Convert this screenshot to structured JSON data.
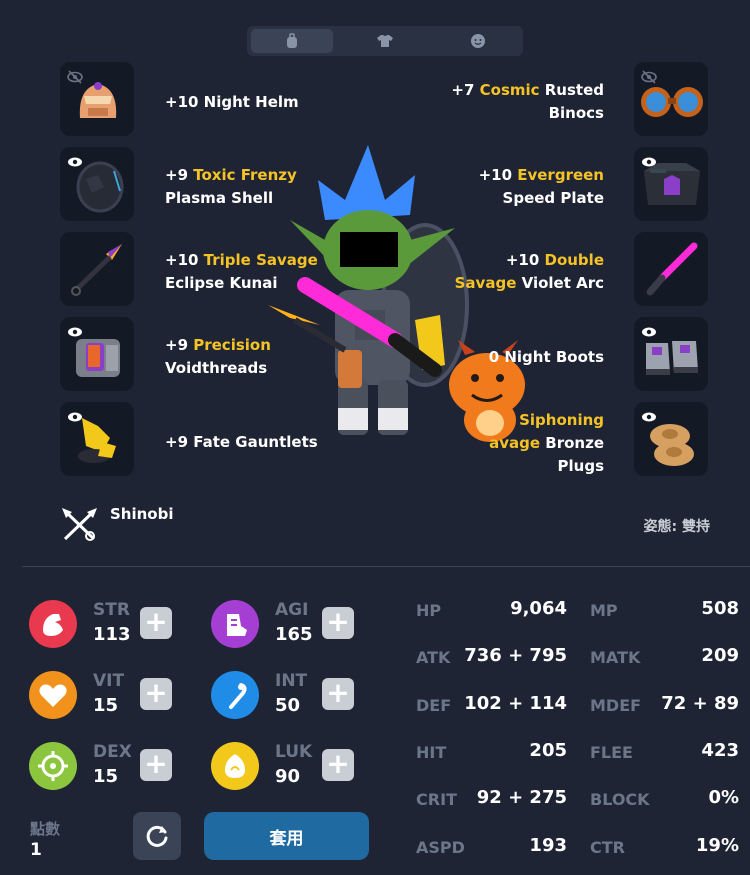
{
  "tabs": [
    {
      "icon": "backpack-icon"
    },
    {
      "icon": "shirt-icon"
    },
    {
      "icon": "face-icon"
    }
  ],
  "equipment_left": [
    {
      "prefix": "+10 ",
      "highlight": "",
      "line1_rest": "Night Helm",
      "line2": "",
      "icon": "night-helm-icon",
      "eye": "eye-off-icon"
    },
    {
      "prefix": "+9 ",
      "highlight": "Toxic  Frenzy",
      "line1_rest": "",
      "line2": "Plasma Shell",
      "icon": "plasma-shell-icon",
      "eye": "eye-icon"
    },
    {
      "prefix": "+10 ",
      "highlight": "Triple Savage",
      "line1_rest": "",
      "line2": "Eclipse Kunai",
      "icon": "eclipse-kunai-icon",
      "eye": ""
    },
    {
      "prefix": "+9 ",
      "highlight": "Precision",
      "line1_rest": "",
      "line2": "Voidthreads",
      "icon": "voidthreads-icon",
      "eye": "eye-icon"
    },
    {
      "prefix": "+9 ",
      "highlight": "",
      "line1_rest": "Fate Gauntlets",
      "line2": "",
      "icon": "fate-gauntlets-icon",
      "eye": "eye-icon"
    }
  ],
  "equipment_right": [
    {
      "prefix": "+7 ",
      "highlight": "Cosmic",
      "line1_rest": " Rusted",
      "line2_hl": "",
      "line2": "Binocs",
      "line3": "",
      "icon": "rusted-binocs-icon",
      "eye": "eye-off-icon"
    },
    {
      "prefix": "+10 ",
      "highlight": "Evergreen",
      "line1_rest": "",
      "line2_hl": "",
      "line2": "Speed Plate",
      "line3": "",
      "icon": "speed-plate-icon",
      "eye": "eye-icon"
    },
    {
      "prefix": "+10 ",
      "highlight": "Double",
      "line1_rest": "",
      "line2_hl": "Savage",
      "line2": " Violet Arc",
      "line3": "",
      "icon": "violet-arc-icon",
      "eye": ""
    },
    {
      "prefix": "",
      "highlight": "",
      "line1_rest": "0 Night Boots",
      "line2_hl": "",
      "line2": "",
      "line3": "",
      "icon": "night-boots-icon",
      "eye": "eye-icon"
    },
    {
      "prefix": "",
      "highlight": "Siphoning",
      "line1_rest": "",
      "line2_hl": "avage",
      "line2": " Bronze",
      "line3": "Plugs",
      "icon": "bronze-plugs-icon",
      "eye": "eye-icon"
    }
  ],
  "job": {
    "name": "Shinobi",
    "icon": "shinobi-icon"
  },
  "stance": "姿態: 雙持",
  "base_stats": [
    {
      "label": "STR",
      "value": "113",
      "color": "#e8394e",
      "icon": "strength-icon"
    },
    {
      "label": "AGI",
      "value": "165",
      "color": "#a53fd4",
      "icon": "agility-icon"
    },
    {
      "label": "VIT",
      "value": "15",
      "color": "#f0921c",
      "icon": "heart-icon"
    },
    {
      "label": "INT",
      "value": "50",
      "color": "#1f8de8",
      "icon": "intelligence-icon"
    },
    {
      "label": "DEX",
      "value": "15",
      "color": "#8cc63e",
      "icon": "target-icon"
    },
    {
      "label": "LUK",
      "value": "90",
      "color": "#f2c81a",
      "icon": "luck-icon"
    }
  ],
  "points": {
    "label": "點數",
    "value": "1"
  },
  "apply_button": "套用",
  "derived_stats": [
    {
      "name": "HP",
      "value": "9,064"
    },
    {
      "name": "MP",
      "value": "508"
    },
    {
      "name": "ATK",
      "value": "736 + 795"
    },
    {
      "name": "MATK",
      "value": "209"
    },
    {
      "name": "DEF",
      "value": "102 + 114"
    },
    {
      "name": "MDEF",
      "value": "72 + 89"
    },
    {
      "name": "HIT",
      "value": "205"
    },
    {
      "name": "FLEE",
      "value": "423"
    },
    {
      "name": "CRIT",
      "value": "92 + 275"
    },
    {
      "name": "BLOCK",
      "value": "0%"
    },
    {
      "name": "ASPD",
      "value": "193"
    },
    {
      "name": "CTR",
      "value": "19%"
    }
  ]
}
